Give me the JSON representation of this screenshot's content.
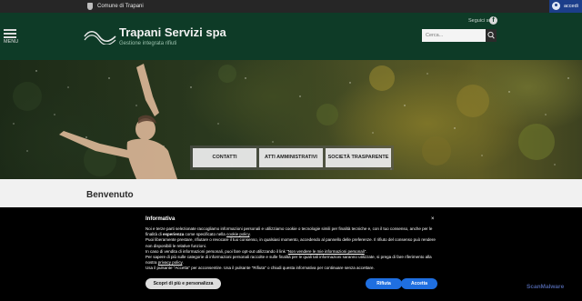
{
  "topbar": {
    "comune_label": "Comune di Trapani",
    "login_label": "accedi",
    "login_color": "#1c3e8a"
  },
  "header": {
    "background_color": "#0e3b27",
    "menu_label": "MENU",
    "social_label": "Seguici su",
    "facebook_glyph": "f",
    "brand_name": "Trapani Servizi spa",
    "tagline": "Gestione integrata rifiuti",
    "search_placeholder": "Cerca...",
    "icons": [
      "hamburger-icon",
      "facebook-icon",
      "wave-logo-icon",
      "search-icon",
      "user-icon"
    ]
  },
  "hero": {
    "quick_links": [
      {
        "label": "CONTATTI"
      },
      {
        "label": "ATTI AMMINISTRATIVI"
      },
      {
        "label": "SOCIETÀ TRASPARENTE"
      }
    ]
  },
  "content": {
    "heading": "Benvenuto"
  },
  "cookie_banner": {
    "title": "Informativa",
    "close_glyph": "×",
    "p1_a": "Noi e terze parti selezionate raccogliamo informazioni personali e utilizziamo cookie o tecnologie simili per finalità tecniche e, con il tuo consenso, anche per le finalità di ",
    "p1_b": "esperienza",
    "p1_c": " come specificato nella ",
    "p1_link": "cookie policy",
    "p1_d": ".",
    "p2": "Puoi liberamente prestare, rifiutare o revocare il tuo consenso, in qualsiasi momento, accedendo al pannello delle preferenze. Il rifiuto del consenso può rendere non disponibili le relative funzioni.",
    "p3_a": "In caso di vendita di informazioni personali, puoi fare opt-out utilizzando il link \"",
    "p3_link": "Non vendere le mie informazioni personali",
    "p3_b": "\".",
    "p4_a": "Per sapere di più sulle categorie di informazioni personali raccolte e sulle finalità per le quali tali informazioni saranno utilizzate, si prega di fare riferimento alla nostra ",
    "p4_link": "privacy policy",
    "p4_b": ".",
    "p5": "Usa il pulsante \"Accetta\" per acconsentire. Usa il pulsante \"Rifiuta\" o chiudi questa informativa per continuare senza accettare.",
    "more_button": "Scopri di più e personalizza",
    "reject_button": "Rifiuta",
    "accept_button": "Accetta",
    "button_color": "#1f6fe0",
    "watermark": "ScanMalware"
  }
}
